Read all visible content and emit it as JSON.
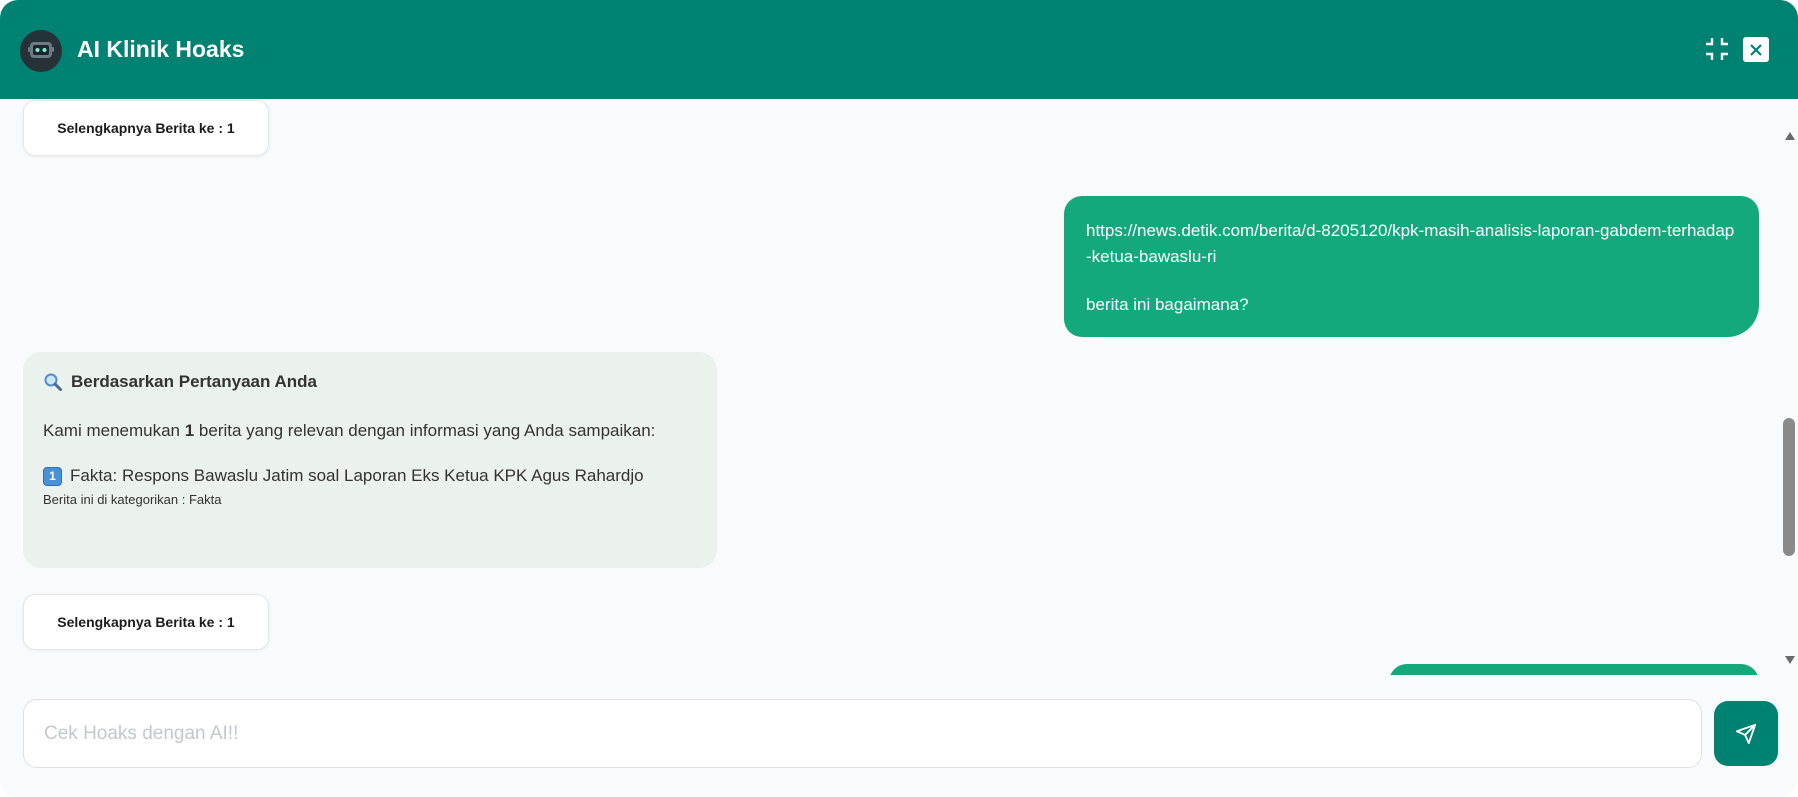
{
  "header": {
    "title": "AI Klinik Hoaks"
  },
  "messages": {
    "chip_top": {
      "label": "Selengkapnya Berita ke : 1"
    },
    "user": {
      "url": "https://news.detik.com/berita/d-8205120/kpk-masih-analisis-laporan-gabdem-terhadap-ketua-bawaslu-ri",
      "question": "berita ini bagaimana?"
    },
    "bot": {
      "heading": "Berdasarkan Pertanyaan Anda",
      "intro_before": "Kami menemukan ",
      "intro_count": "1",
      "intro_after": " berita yang relevan dengan informasi yang Anda sampaikan:",
      "item_number": "1",
      "item_text": "Fakta: Respons Bawaslu Jatim soal Laporan Eks Ketua KPK Agus Rahardjo",
      "category": "Berita ini di kategorikan : Fakta"
    },
    "chip_bottom": {
      "label": "Selengkapnya Berita ke : 1"
    }
  },
  "input": {
    "placeholder": "Cek Hoaks dengan AI!!",
    "value": ""
  },
  "colors": {
    "header": "#008272",
    "user_bubble": "#13a97c",
    "bot_bubble": "#ebf1ed",
    "send_button": "#008272"
  }
}
